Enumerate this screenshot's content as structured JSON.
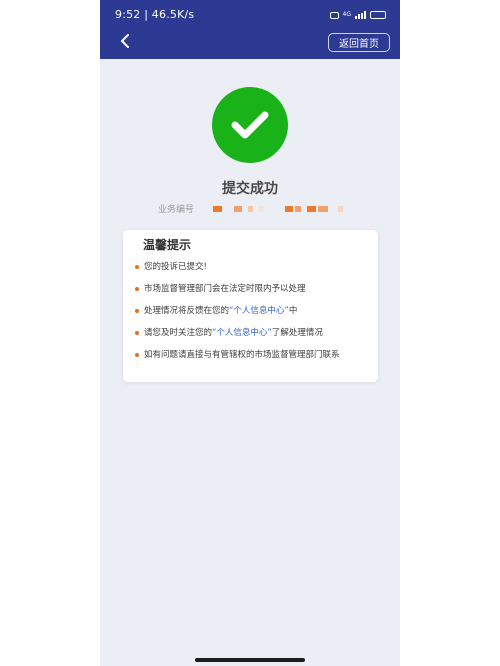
{
  "status_bar": {
    "time": "9:52 | 46.5K/s",
    "network": "4G",
    "battery": "100"
  },
  "header": {
    "back_icon": "chevron-left-icon",
    "home_button_label": "返回首页"
  },
  "result": {
    "icon": "check-circle-icon",
    "title": "提交成功",
    "business_number_label": "业务编号"
  },
  "notice": {
    "title": "温馨提示",
    "items": [
      {
        "text": "您的投诉已提交!"
      },
      {
        "text": "市场监督管理部门会在法定时限内予以处理"
      },
      {
        "pre": "处理情况将反馈在您的",
        "link": "“个人信息中心”",
        "post": "中"
      },
      {
        "pre": "请您及时关注您的",
        "link": "“个人信息中心”",
        "post": "了解处理情况"
      },
      {
        "text": "如有问题请直接与有管辖权的市场监督管理部门联系"
      }
    ]
  },
  "colors": {
    "header_bg": "#2c3a94",
    "success_green": "#19b319",
    "bullet_orange": "#e8701e",
    "link_blue": "#2f63c4"
  }
}
